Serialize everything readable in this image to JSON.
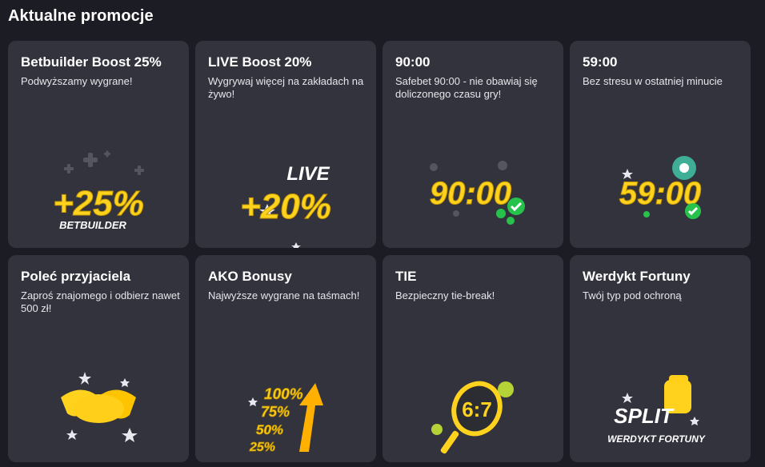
{
  "section": {
    "title": "Aktualne promocje"
  },
  "promotions": [
    {
      "title": "Betbuilder Boost 25%",
      "desc": "Podwyższamy wygrane!",
      "art_text": "+25%",
      "art_sub": "BETBUILDER"
    },
    {
      "title": "LIVE Boost 20%",
      "desc": "Wygrywaj więcej na zakładach na żywo!",
      "art_text": "+20%",
      "art_sub": "LIVE"
    },
    {
      "title": "90:00",
      "desc": "Safebet 90:00 - nie obawiaj się doliczonego czasu gry!",
      "art_text": "90:00"
    },
    {
      "title": "59:00",
      "desc": "Bez stresu w ostatniej minucie",
      "art_text": "59:00"
    },
    {
      "title": "Poleć przyjaciela",
      "desc": "Zaproś znajomego i odbierz nawet 500 zł!"
    },
    {
      "title": "AKO Bonusy",
      "desc": "Najwyższe wygrane na taśmach!",
      "art_lines": [
        "100%",
        "75%",
        "50%",
        "25%"
      ]
    },
    {
      "title": "TIE",
      "desc": "Bezpieczny tie-break!",
      "art_text": "6:7"
    },
    {
      "title": "Werdykt Fortuny",
      "desc": "Twój typ pod ochroną",
      "art_text": "SPLIT",
      "art_sub": "WERDYKT FORTUNY"
    }
  ],
  "colors": {
    "yellow": "#ffd21e",
    "green": "#27c24c",
    "card": "#33333e",
    "bg": "#1c1c24"
  },
  "icons": [
    "plus-icon",
    "star-icon",
    "check-icon",
    "soccer-ball-icon",
    "handshake-icon",
    "arrow-up-icon",
    "tennis-racket-icon",
    "tennis-ball-icon",
    "fist-icon"
  ]
}
